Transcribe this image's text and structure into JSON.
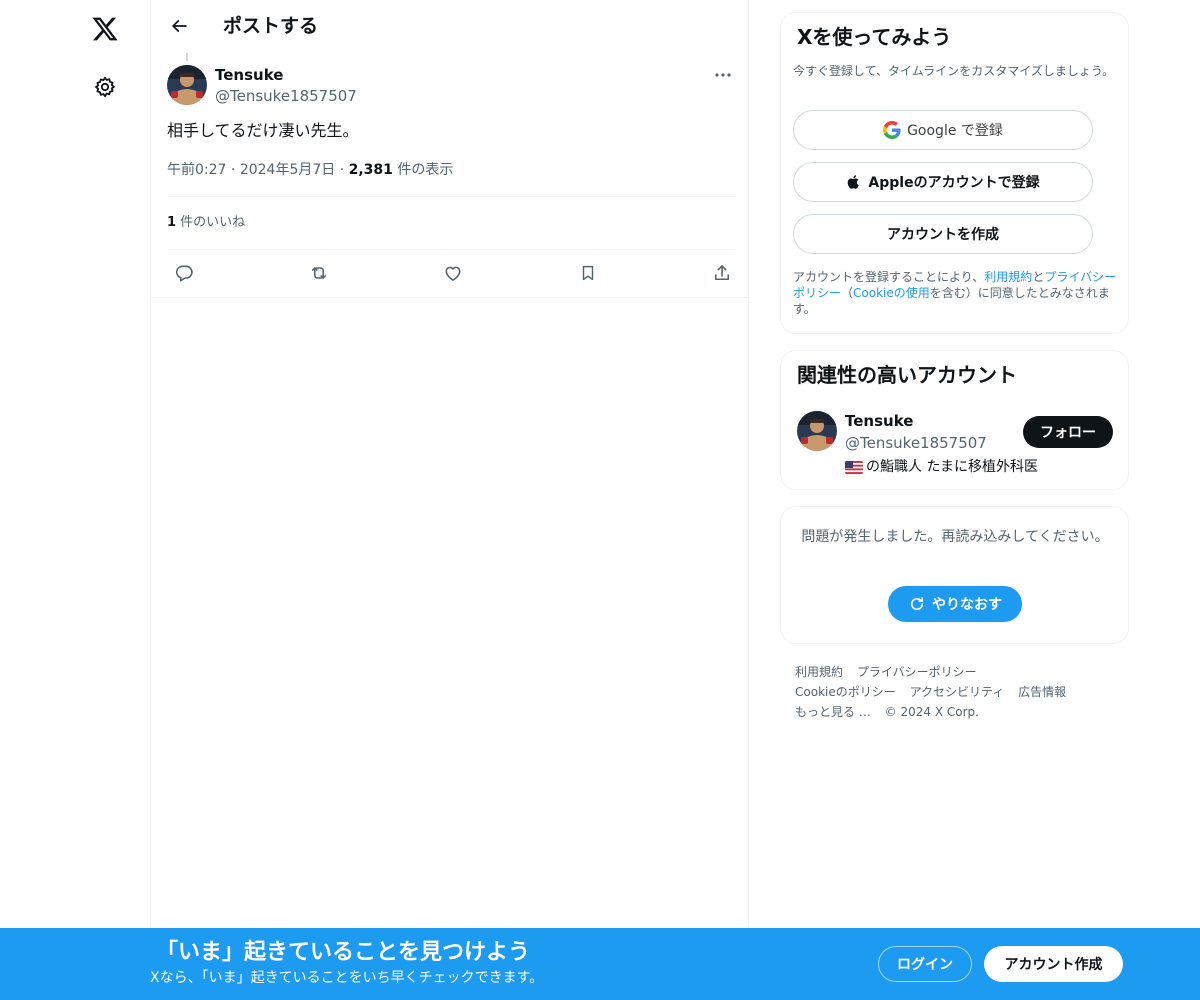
{
  "nav": {
    "logo_icon": "x-logo-icon",
    "settings_icon": "gear-icon"
  },
  "header": {
    "back_icon": "arrow-left-icon",
    "title": "ポストする"
  },
  "post": {
    "author_name": "Tensuke",
    "author_handle": "@Tensuke1857507",
    "text": "相手してるだけ凄い先生。",
    "time": "午前0:27",
    "date": "2024年5月7日",
    "views_count": "2,381",
    "views_label": " 件の表示",
    "likes_count": "1",
    "likes_label": " 件のいいね",
    "actions": [
      "reply-icon",
      "repost-icon",
      "like-icon",
      "bookmark-icon",
      "share-icon"
    ]
  },
  "signup": {
    "title": "Xを使ってみよう",
    "subtitle": "今すぐ登録して、タイムラインをカスタマイズしましょう。",
    "google_label": "Google で登録",
    "apple_label": "Appleのアカウントで登録",
    "create_label": "アカウントを作成",
    "terms_pre": "アカウントを登録することにより、",
    "terms_link1": "利用規約",
    "terms_mid1": "と",
    "terms_link2": "プライバシーポリシー",
    "terms_mid2": "（",
    "terms_link3": "Cookieの使用",
    "terms_post": "を含む）に同意したとみなされます。"
  },
  "related": {
    "title": "関連性の高いアカウント",
    "name": "Tensuke",
    "handle": "@Tensuke1857507",
    "bio": "の鮨職人 たまに移植外科医",
    "follow_label": "フォロー"
  },
  "error": {
    "message": "問題が発生しました。再読み込みしてください。",
    "retry_label": "やりなおす"
  },
  "footer": {
    "links": [
      "利用規約",
      "プライバシーポリシー",
      "Cookieのポリシー",
      "アクセシビリティ",
      "広告情報",
      "もっと見る …",
      "© 2024 X Corp."
    ]
  },
  "bottom_bar": {
    "title": "「いま」起きていることを見つけよう",
    "subtitle": "Xなら、「いま」起きていることをいち早くチェックできます。",
    "login_label": "ログイン",
    "signup_label": "アカウント作成"
  },
  "colors": {
    "accent": "#1d9bf0",
    "text": "#0f1419",
    "muted": "#536471",
    "border": "#eff3f4"
  }
}
